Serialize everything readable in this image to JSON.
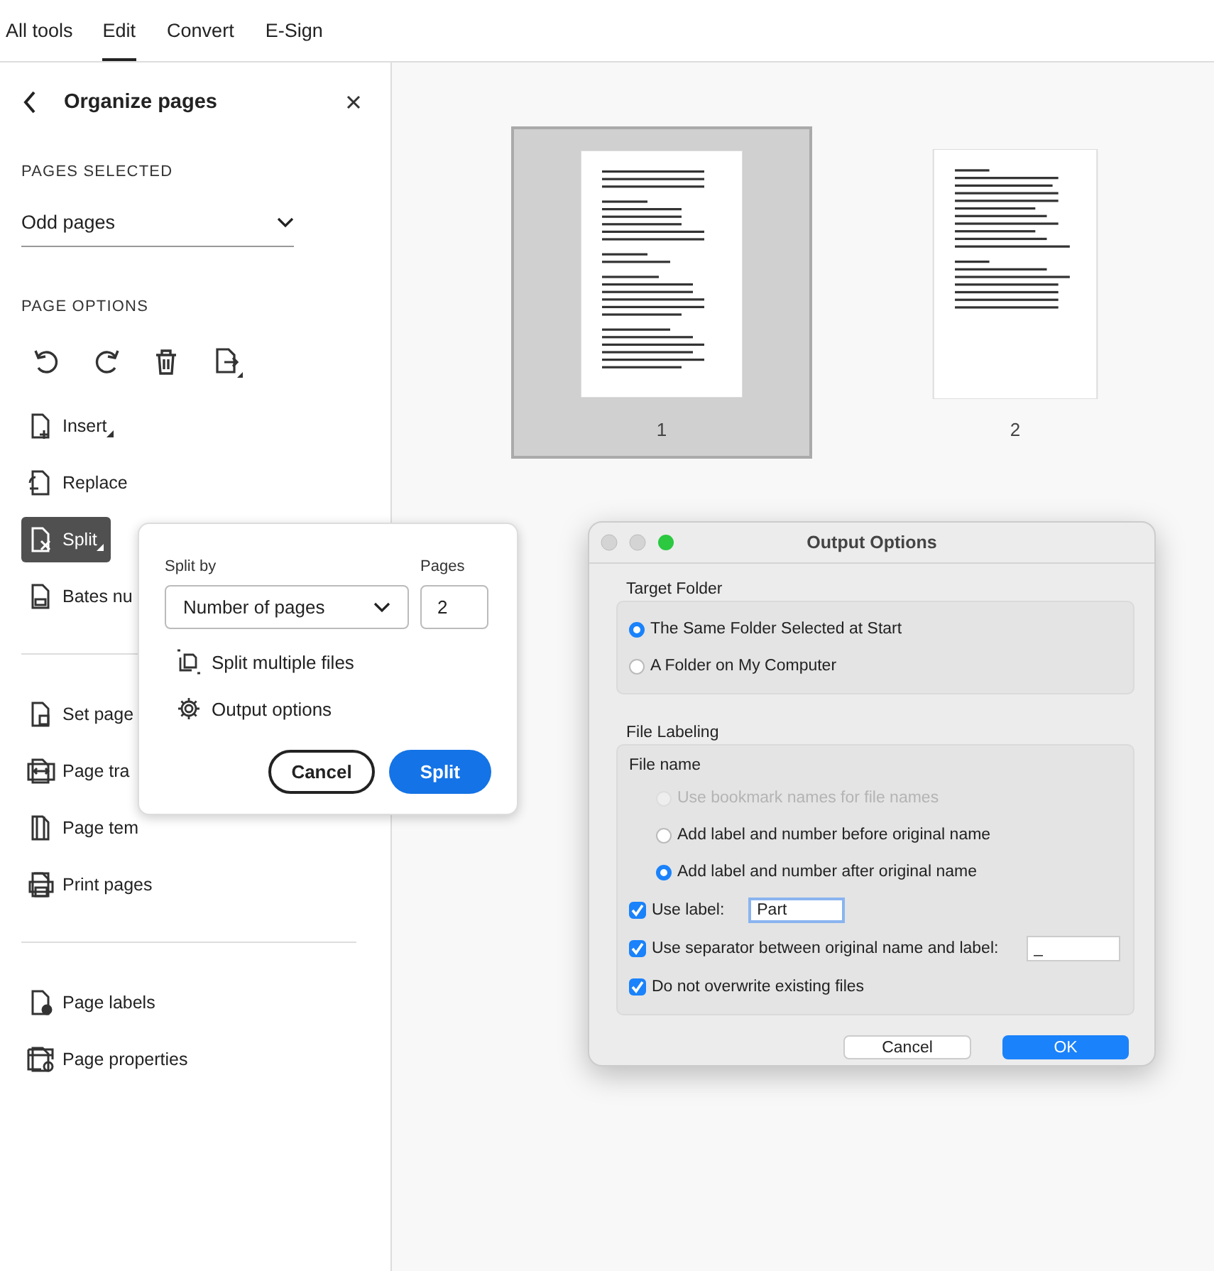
{
  "top_tabs": [
    {
      "label": "All tools",
      "selected": false
    },
    {
      "label": "Edit",
      "selected": true
    },
    {
      "label": "Convert",
      "selected": false
    },
    {
      "label": "E-Sign",
      "selected": false
    }
  ],
  "panel": {
    "title": "Organize pages",
    "pages_selected_label": "PAGES SELECTED",
    "pages_selected_value": "Odd pages",
    "page_options_label": "PAGE OPTIONS",
    "groups": [
      [
        {
          "label": "Insert",
          "submenu": true,
          "selected": false
        },
        {
          "label": "Replace",
          "submenu": false,
          "selected": false
        },
        {
          "label": "Split",
          "submenu": true,
          "selected": true
        },
        {
          "label": "Bates nu",
          "submenu": false,
          "selected": false
        }
      ],
      [
        {
          "label": "Set page",
          "submenu": false,
          "selected": false
        },
        {
          "label": "Page tra",
          "submenu": false,
          "selected": false
        },
        {
          "label": "Page tem",
          "submenu": false,
          "selected": false
        },
        {
          "label": "Print pages",
          "submenu": false,
          "selected": false
        }
      ],
      [
        {
          "label": "Page labels",
          "submenu": false,
          "selected": false
        },
        {
          "label": "Page properties",
          "submenu": false,
          "selected": false
        }
      ]
    ]
  },
  "pages": [
    {
      "label": "1",
      "selected": true
    },
    {
      "label": "2",
      "selected": false
    }
  ],
  "split_popover": {
    "split_by_label": "Split by",
    "split_by_value": "Number of pages",
    "pages_label": "Pages",
    "pages_value": "2",
    "links": [
      "Split multiple files",
      "Output options"
    ],
    "cancel": "Cancel",
    "confirm": "Split"
  },
  "dialog": {
    "title": "Output Options",
    "target_folder_label": "Target Folder",
    "target_options": [
      {
        "label": "The Same Folder Selected at Start",
        "selected": true
      },
      {
        "label": "A Folder on My Computer",
        "selected": false
      }
    ],
    "file_labeling_label": "File Labeling",
    "file_name_label": "File name",
    "name_options": [
      {
        "label": "Use bookmark names for file names",
        "selected": false,
        "disabled": true
      },
      {
        "label": "Add label and number before original name",
        "selected": false,
        "disabled": false
      },
      {
        "label": "Add label and number after original name",
        "selected": true,
        "disabled": false
      }
    ],
    "checks": [
      {
        "label": "Use label:",
        "checked": true,
        "kind": "field",
        "value": "Part"
      },
      {
        "label": "Use separator between original name and label:",
        "checked": true,
        "kind": "field",
        "value": "_"
      },
      {
        "label": "Do not overwrite existing files",
        "checked": true,
        "kind": "plain"
      }
    ],
    "cancel": "Cancel",
    "ok": "OK"
  }
}
